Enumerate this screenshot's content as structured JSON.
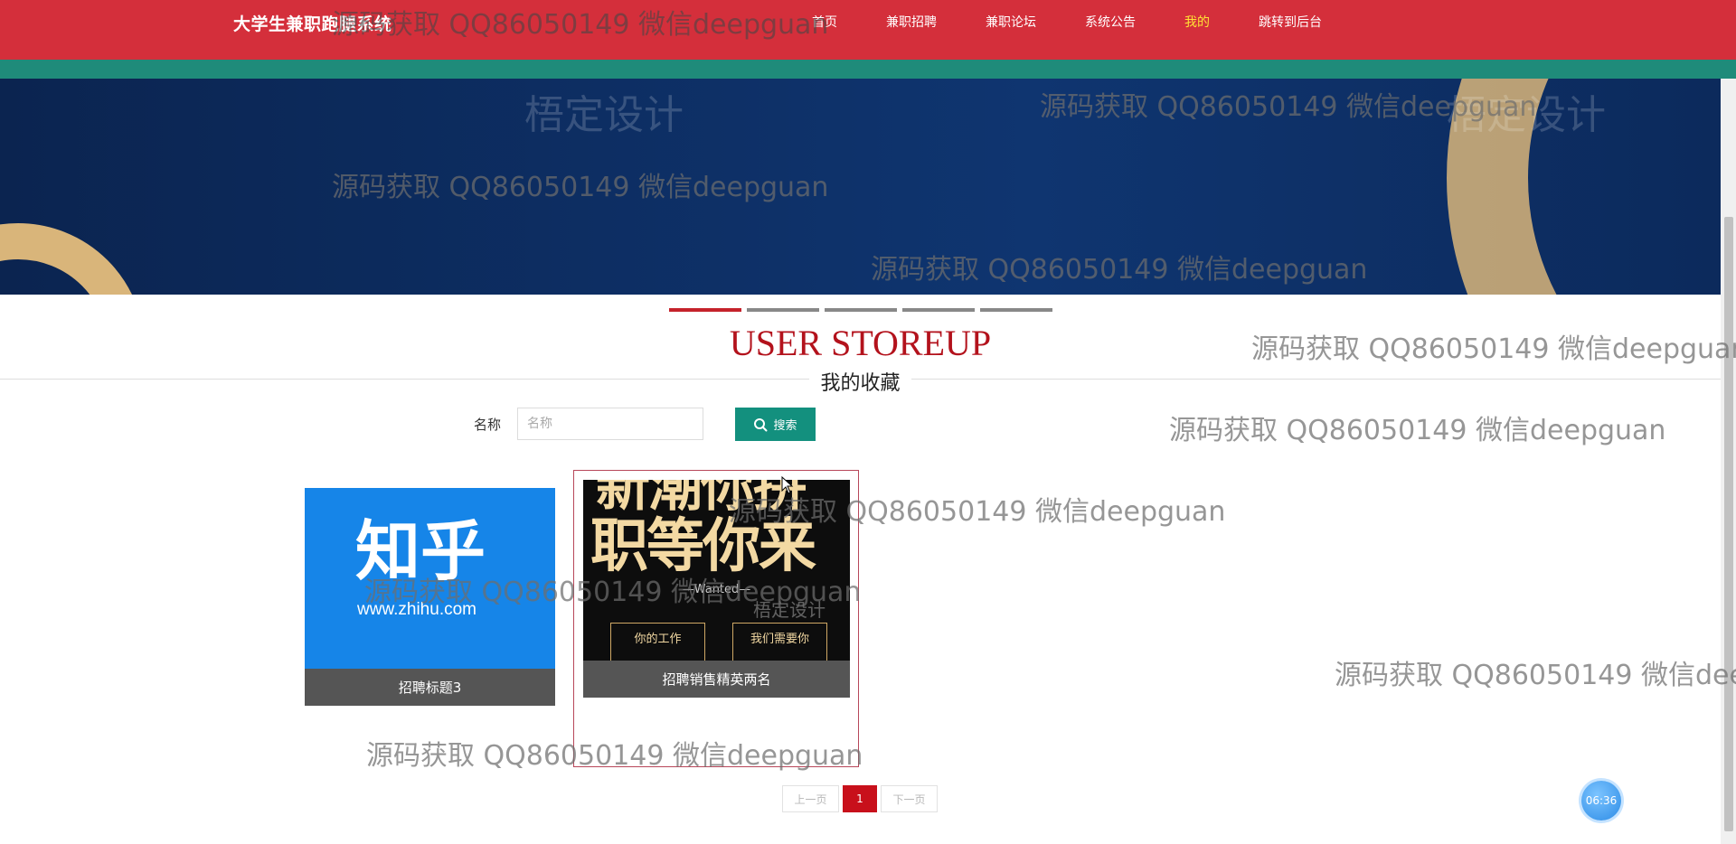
{
  "nav": {
    "title": "大学生兼职跑腿系统",
    "links": [
      "首页",
      "兼职招聘",
      "兼职论坛",
      "系统公告",
      "我的",
      "跳转到后台"
    ],
    "active_index": 4
  },
  "banner": {
    "design_mark": "梧定设计"
  },
  "carousel": {
    "count": 5,
    "active_index": 0
  },
  "section": {
    "title": "USER STOREUP",
    "subtitle": "我的收藏"
  },
  "search": {
    "label": "名称",
    "placeholder": "名称",
    "value": "",
    "button_label": "搜索"
  },
  "cards": [
    {
      "caption": "招聘标题3",
      "image": {
        "logo": "知乎",
        "url": "www.zhihu.com"
      }
    },
    {
      "caption": "招聘销售精英两名",
      "image": {
        "line1": "新潮你拼",
        "line2": "职等你来",
        "wanted": "—Wanted—",
        "box_left": "你的工作",
        "box_right": "我们需要你",
        "design_mark": "梧定设计"
      }
    }
  ],
  "pagination": {
    "prev": "上一页",
    "current": "1",
    "next": "下一页"
  },
  "clock": "06:36",
  "watermark_text": "源码获取 QQ86050149 微信deepguan",
  "colors": {
    "nav_bg": "#d42f3b",
    "teal_strip": "#1f8b7a",
    "title_red": "#b3121c",
    "search_button": "#13907e",
    "page_current": "#c8101b",
    "nav_active": "#ffe135"
  }
}
